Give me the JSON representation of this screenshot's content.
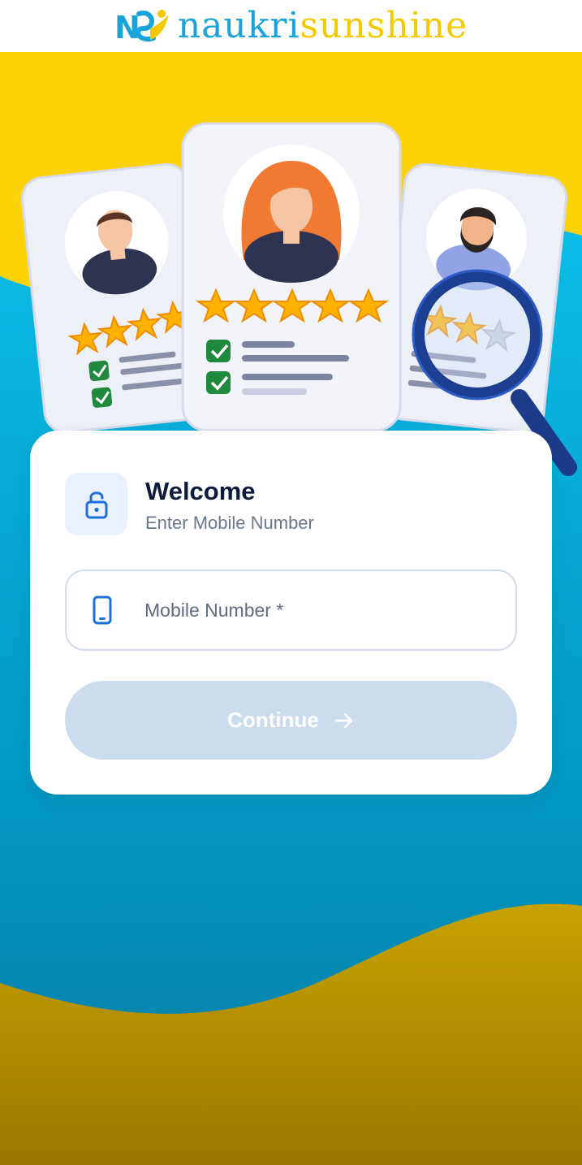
{
  "header": {
    "logo_text_a": "naukri",
    "logo_text_b": "sunshine",
    "logo_mark_letters": "NS"
  },
  "colors": {
    "brand_blue": "#1aa3d8",
    "brand_yellow": "#f4c900",
    "accent_blue": "#1e6fd9",
    "button_disabled": "#ccdcef"
  },
  "hero": {
    "illustration": "candidate-rating-cards",
    "cards": [
      {
        "icon": "male-avatar-icon",
        "rating": 4
      },
      {
        "icon": "female-avatar-icon",
        "rating": 5
      },
      {
        "icon": "bearded-avatar-icon",
        "rating": 3
      }
    ],
    "magnifier": "magnifying-glass-icon"
  },
  "login": {
    "icon": "lock-icon",
    "title": "Welcome",
    "subtitle": "Enter Mobile Number",
    "mobile_field": {
      "icon": "phone-icon",
      "placeholder": "Mobile Number *",
      "value": ""
    },
    "continue_button": {
      "label": "Continue",
      "icon": "arrow-right-icon",
      "enabled": false
    }
  }
}
